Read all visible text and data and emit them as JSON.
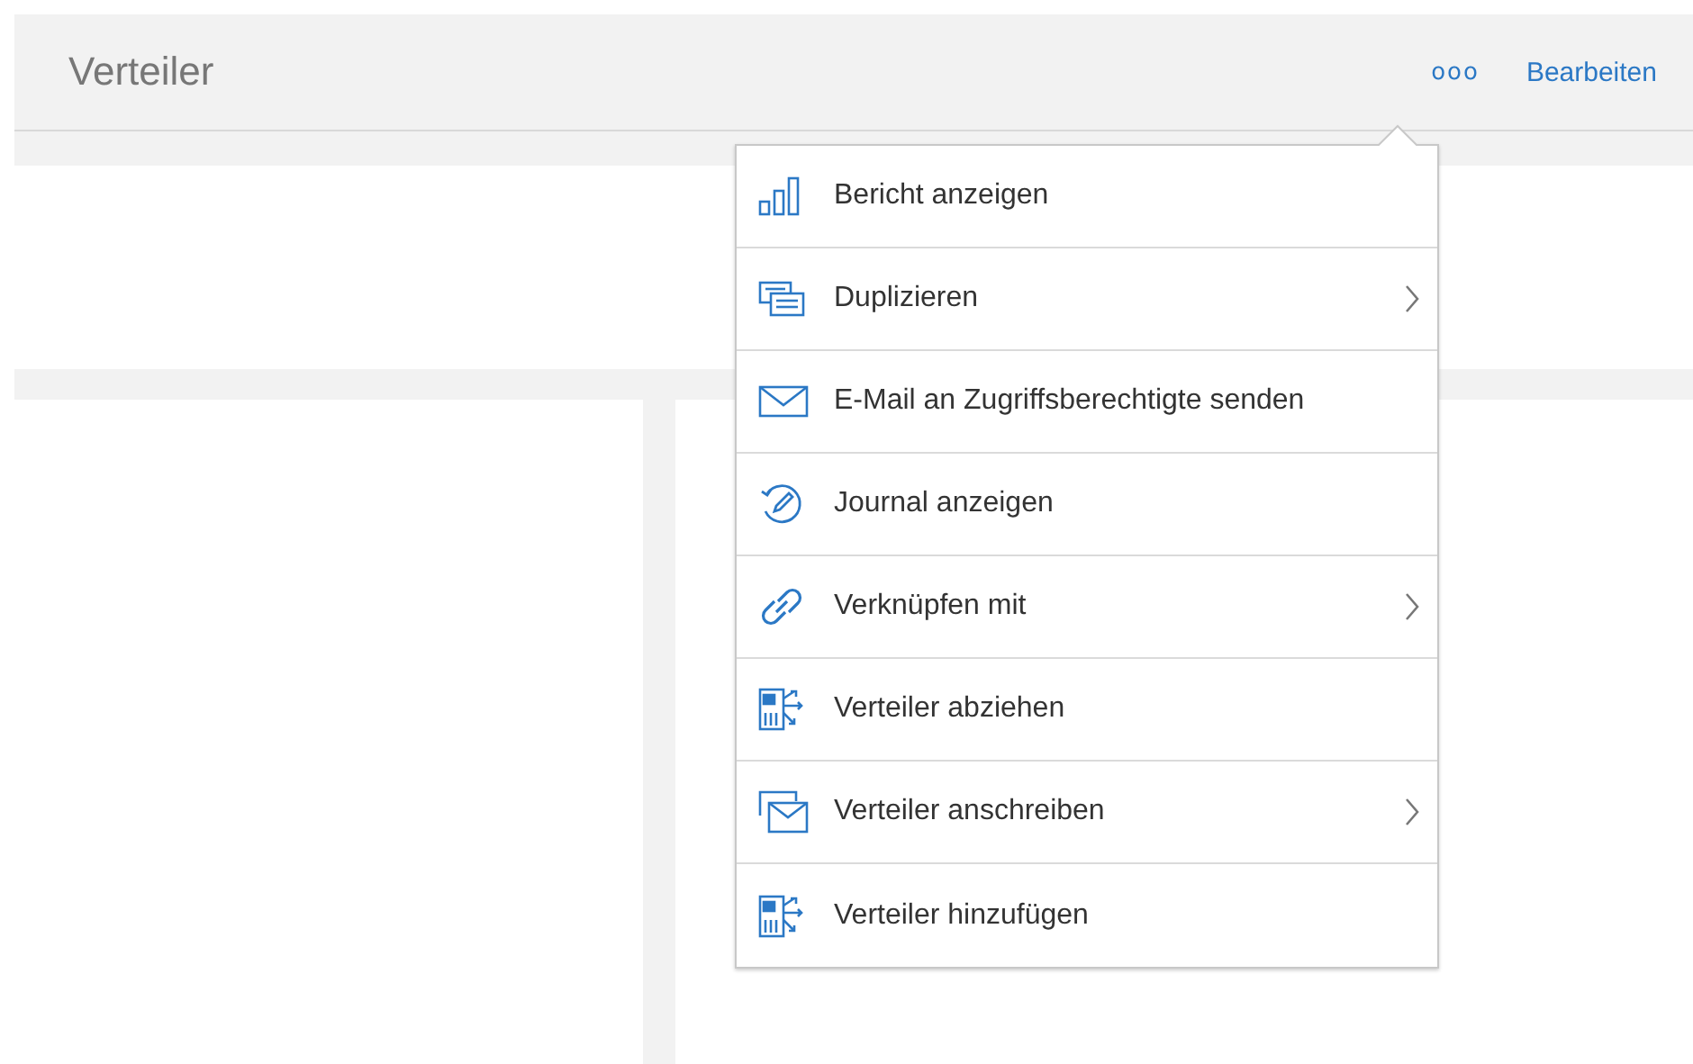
{
  "header": {
    "title": "Verteiler",
    "more_button": "ooo",
    "edit_link": "Bearbeiten"
  },
  "menu": {
    "items": [
      {
        "kind": "report",
        "label": "Bericht anzeigen",
        "submenu": false
      },
      {
        "kind": "duplicate",
        "label": "Duplizieren",
        "submenu": true
      },
      {
        "kind": "mail",
        "label": "E-Mail an Zugriffsberechtigte senden",
        "submenu": false
      },
      {
        "kind": "journal",
        "label": "Journal anzeigen",
        "submenu": false
      },
      {
        "kind": "link",
        "label": "Verknüpfen mit",
        "submenu": true
      },
      {
        "kind": "distribution",
        "label": "Verteiler abziehen",
        "submenu": false
      },
      {
        "kind": "mailstack",
        "label": "Verteiler anschreiben",
        "submenu": true
      },
      {
        "kind": "distribution",
        "label": "Verteiler hinzufügen",
        "submenu": false
      }
    ]
  }
}
